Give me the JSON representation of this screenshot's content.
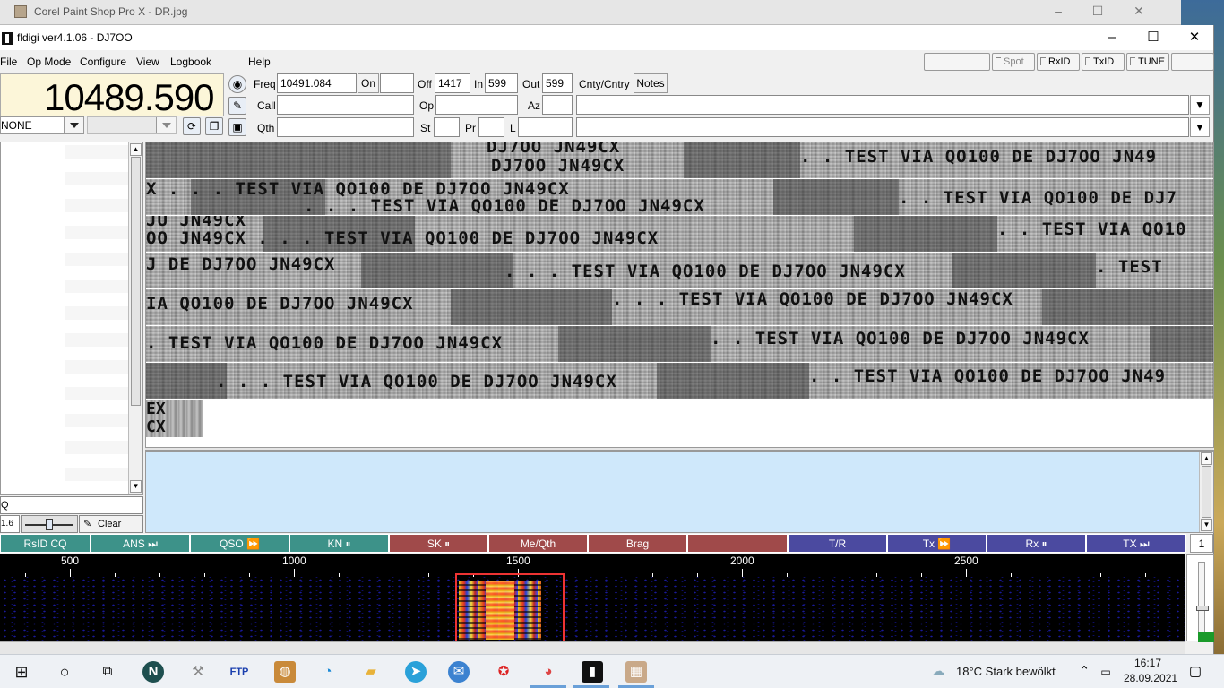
{
  "background_window": {
    "title": "Corel Paint Shop Pro X - DR.jpg"
  },
  "window": {
    "title": "fldigi ver4.1.06 - DJ7OO"
  },
  "menu": {
    "file": "File",
    "opmode": "Op Mode",
    "configure": "Configure",
    "view": "View",
    "logbook": "Logbook",
    "help": "Help"
  },
  "toolbar_right": {
    "spot": "Spot",
    "rxid": "RxID",
    "txid": "TxID",
    "tune": "TUNE"
  },
  "freq_display": "10489.590",
  "mode_combo": "NONE",
  "log": {
    "freq_label": "Freq",
    "freq_value": "10491.084",
    "on_label": "On",
    "on_value": "",
    "off_label": "Off",
    "off_value": "1417",
    "in_label": "In",
    "in_value": "599",
    "out_label": "Out",
    "out_value": "599",
    "cnty_label": "Cnty/Cntry",
    "notes_label": "Notes",
    "call_label": "Call",
    "call_value": "",
    "op_label": "Op",
    "op_value": "",
    "az_label": "Az",
    "az_value": "",
    "qth_label": "Qth",
    "qth_value": "",
    "st_label": "St",
    "st_value": "",
    "pr_label": "Pr",
    "pr_value": "",
    "l_label": "L",
    "l_value": ""
  },
  "left_panel": {
    "q_field": "Q",
    "slider_value": "1.6",
    "clear_label": "Clear"
  },
  "rx_lines": [
    {
      "a": "DJ7OO JN49CX",
      "b": ". . TEST VIA QO100 DE DJ7OO JN49",
      "c": "DJ7OO JN49CX"
    },
    {
      "a": "X . . . TEST VIA QO100 DE DJ7OO JN49CX",
      "b": ". . TEST VIA QO100 DE DJ7",
      "c": ". . . TEST VIA QO100 DE DJ7OO JN49CX"
    },
    {
      "a": "JU JN49CX",
      "b": "OO JN49CX . . . TEST VIA QO100 DE DJ7OO JN49CX",
      "c": ". . TEST VIA QO10"
    },
    {
      "a": "J DE DJ7OO JN49CX",
      "b": ". . . TEST VIA QO100 DE DJ7OO JN49CX",
      "c": ". TEST"
    },
    {
      "a": "IA QO100 DE DJ7OO JN49CX",
      "b": ". . . TEST VIA QO100 DE DJ7OO JN49CX",
      "c": ""
    },
    {
      "a": ". TEST VIA QO100 DE DJ7OO JN49CX",
      "b": ". . TEST VIA QO100 DE DJ7OO JN49CX",
      "c": ""
    },
    {
      "a": ". . . TEST VIA QO100 DE DJ7OO JN49CX",
      "b": ". . TEST VIA QO100 DE DJ7OO JN49",
      "c": ""
    }
  ],
  "rx_tail": [
    "EX",
    "CX"
  ],
  "macros": [
    {
      "label": "RsID CQ",
      "color": "teal"
    },
    {
      "label": "ANS ⏭",
      "color": "teal"
    },
    {
      "label": "QSO ⏩",
      "color": "teal"
    },
    {
      "label": "KN ⏸",
      "color": "teal"
    },
    {
      "label": "SK ⏸",
      "color": "red"
    },
    {
      "label": "Me/Qth",
      "color": "red"
    },
    {
      "label": "Brag",
      "color": "red"
    },
    {
      "label": "",
      "color": "red"
    },
    {
      "label": "T/R",
      "color": "blue"
    },
    {
      "label": "Tx ⏩",
      "color": "blue"
    },
    {
      "label": "Rx ⏸",
      "color": "blue"
    },
    {
      "label": "TX ⏭",
      "color": "blue"
    }
  ],
  "macro_set": "1",
  "waterfall_scale": [
    "500",
    "1000",
    "1500",
    "2000",
    "2500"
  ],
  "taskbar": {
    "weather": "18°C  Stark bewölkt",
    "time": "16:17",
    "date": "28.09.2021"
  }
}
